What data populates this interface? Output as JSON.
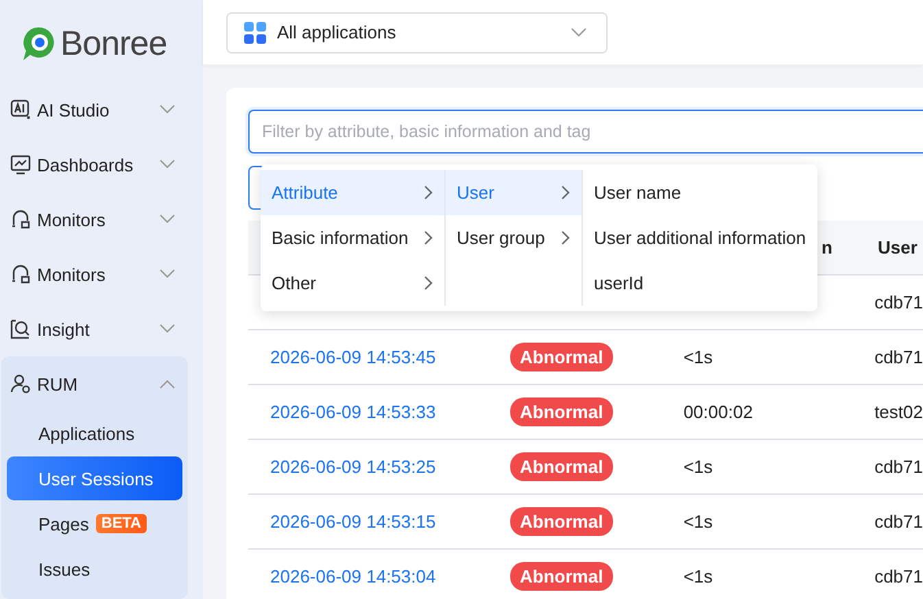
{
  "sidebar": {
    "logo": "Bonree",
    "items": [
      {
        "label": "AI Studio",
        "kind": "ai",
        "expanded": false
      },
      {
        "label": "Dashboards",
        "kind": "chart",
        "expanded": false
      },
      {
        "label": "Monitors",
        "kind": "monitor",
        "expanded": false
      },
      {
        "label": "Monitors",
        "kind": "monitor",
        "expanded": false
      },
      {
        "label": "Insight",
        "kind": "insight",
        "expanded": false
      },
      {
        "label": "RUM",
        "kind": "user",
        "expanded": true,
        "children": [
          {
            "label": "Applications",
            "selected": false
          },
          {
            "label": "User Sessions",
            "selected": true
          },
          {
            "label": "Pages",
            "selected": false,
            "badge": "BETA"
          },
          {
            "label": "Issues",
            "selected": false
          }
        ]
      }
    ]
  },
  "app_select": {
    "value": "All applications"
  },
  "filter": {
    "placeholder": "Filter by attribute, basic information and tag"
  },
  "cascader": {
    "columns": [
      {
        "items": [
          {
            "label": "Attribute",
            "selected": true,
            "has_children": true
          },
          {
            "label": "Basic information",
            "selected": false,
            "has_children": true
          },
          {
            "label": "Other",
            "selected": false,
            "has_children": true
          }
        ]
      },
      {
        "items": [
          {
            "label": "User",
            "selected": true,
            "has_children": true
          },
          {
            "label": "User group",
            "selected": false,
            "has_children": true
          }
        ]
      },
      {
        "items": [
          {
            "label": "User name",
            "selected": false,
            "has_children": false
          },
          {
            "label": "User additional information",
            "selected": false,
            "has_children": false
          },
          {
            "label": "userId",
            "selected": false,
            "has_children": false
          }
        ]
      }
    ]
  },
  "table": {
    "columns": [
      "n",
      "User"
    ],
    "rows": [
      {
        "user": "cdb71"
      },
      {
        "time": "2026-06-09 14:53:45",
        "status": {
          "label": "Abnormal",
          "kind": "abnormal"
        },
        "duration": "<1s",
        "user": "cdb71"
      },
      {
        "time": "2026-06-09 14:53:33",
        "status": {
          "label": "Abnormal",
          "kind": "abnormal"
        },
        "duration": "00:00:02",
        "user": "test02"
      },
      {
        "time": "2026-06-09 14:53:25",
        "status": {
          "label": "Abnormal",
          "kind": "abnormal"
        },
        "duration": "<1s",
        "user": "cdb71"
      },
      {
        "time": "2026-06-09 14:53:15",
        "status": {
          "label": "Abnormal",
          "kind": "abnormal"
        },
        "duration": "<1s",
        "user": "cdb71"
      },
      {
        "time": "2026-06-09 14:53:04",
        "status": {
          "label": "Abnormal",
          "kind": "abnormal"
        },
        "duration": "<1s",
        "user": "cdb71"
      }
    ]
  }
}
